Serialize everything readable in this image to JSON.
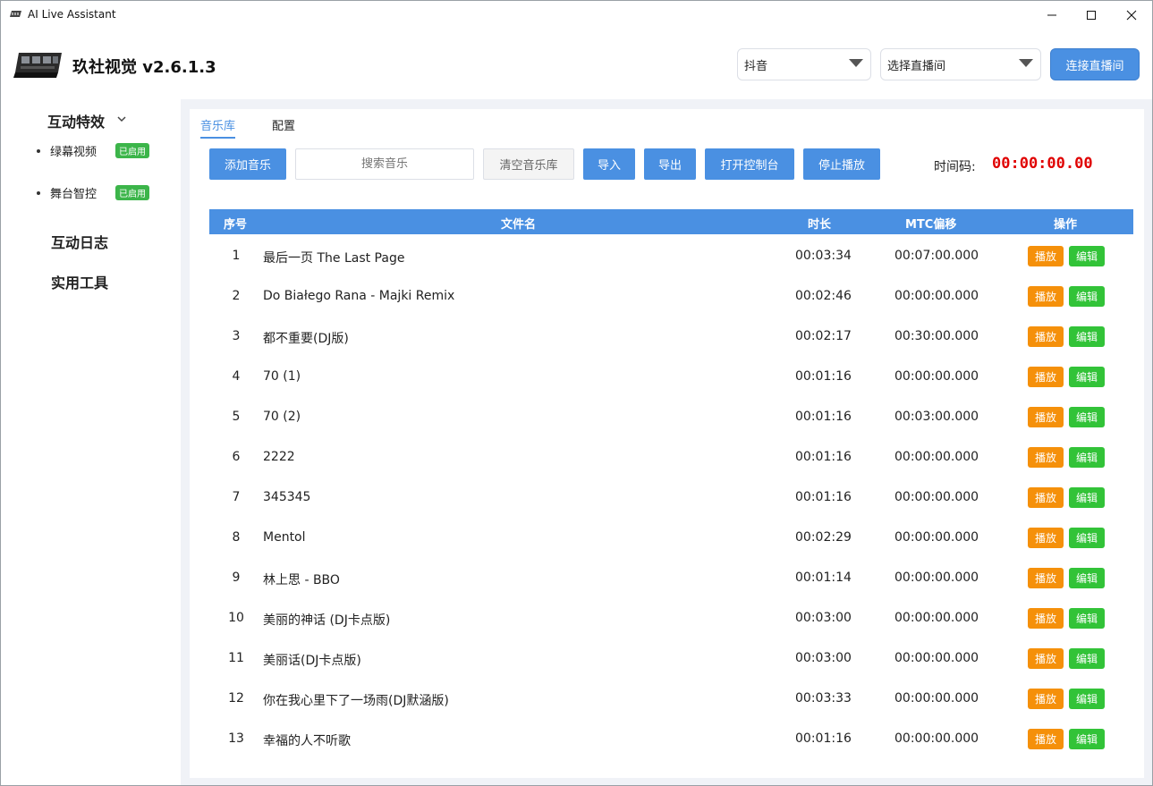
{
  "window": {
    "title": "AI Live Assistant"
  },
  "header": {
    "brand": "玖社视觉 v2.6.1.3",
    "platform_select": "抖音",
    "room_select": "选择直播间",
    "connect_label": "连接直播间"
  },
  "sidebar": {
    "group_label": "互动特效",
    "sub_items": [
      {
        "label": "绿幕视频",
        "badge": "已启用"
      },
      {
        "label": "舞台智控",
        "badge": "已启用"
      }
    ],
    "main_items": [
      "互动日志",
      "实用工具"
    ]
  },
  "tabs": [
    "音乐库",
    "配置"
  ],
  "toolbar": {
    "add_music": "添加音乐",
    "search_placeholder": "搜索音乐",
    "clear_library": "清空音乐库",
    "import": "导入",
    "export": "导出",
    "open_console": "打开控制台",
    "stop_play": "停止播放",
    "timecode_label": "时间码:",
    "timecode_value": "00:00:00.00"
  },
  "table": {
    "headers": [
      "序号",
      "文件名",
      "时长",
      "MTC偏移",
      "操作"
    ],
    "play_label": "播放",
    "edit_label": "编辑",
    "rows": [
      {
        "idx": "1",
        "name": "最后一页 The Last Page",
        "dur": "00:03:34",
        "mtc": "00:07:00.000"
      },
      {
        "idx": "2",
        "name": "Do Białego Rana - Majki Remix",
        "dur": "00:02:46",
        "mtc": "00:00:00.000"
      },
      {
        "idx": "3",
        "name": "都不重要(DJ版)",
        "dur": "00:02:17",
        "mtc": "00:30:00.000"
      },
      {
        "idx": "4",
        "name": "70 (1)",
        "dur": "00:01:16",
        "mtc": "00:00:00.000"
      },
      {
        "idx": "5",
        "name": "70 (2)",
        "dur": "00:01:16",
        "mtc": "00:03:00.000"
      },
      {
        "idx": "6",
        "name": "2222",
        "dur": "00:01:16",
        "mtc": "00:00:00.000"
      },
      {
        "idx": "7",
        "name": "345345",
        "dur": "00:01:16",
        "mtc": "00:00:00.000"
      },
      {
        "idx": "8",
        "name": "Mentol",
        "dur": "00:02:29",
        "mtc": "00:00:00.000"
      },
      {
        "idx": "9",
        "name": "林上思 - BBO",
        "dur": "00:01:14",
        "mtc": "00:00:00.000"
      },
      {
        "idx": "10",
        "name": "美丽的神话 (DJ卡点版)",
        "dur": "00:03:00",
        "mtc": "00:00:00.000"
      },
      {
        "idx": "11",
        "name": "美丽话(DJ卡点版)",
        "dur": "00:03:00",
        "mtc": "00:00:00.000"
      },
      {
        "idx": "12",
        "name": "你在我心里下了一场雨(DJ默涵版)",
        "dur": "00:03:33",
        "mtc": "00:00:00.000"
      },
      {
        "idx": "13",
        "name": "幸福的人不听歌",
        "dur": "00:01:16",
        "mtc": "00:00:00.000"
      }
    ]
  }
}
